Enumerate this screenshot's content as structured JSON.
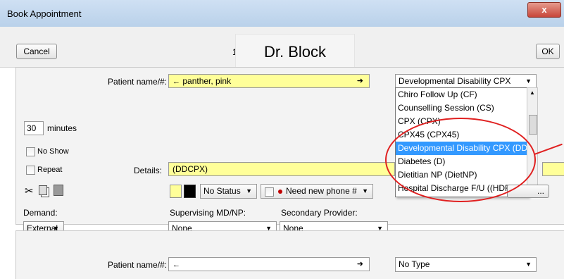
{
  "window": {
    "title": "Book Appointment",
    "close_glyph": "x"
  },
  "toolbar": {
    "cancel_label": "Cancel",
    "ok_label": "OK",
    "provider_callout": "Dr. Block",
    "stub_text": "1"
  },
  "appointment": {
    "patient_label": "Patient name/#:",
    "patient_value": "panther, pink",
    "type_selected": "Developmental Disability CPX (DDCPX)",
    "type_options": [
      "Chiro Follow Up (CF)",
      "Counselling Session (CS)",
      "CPX (CPX)",
      "CPX45 (CPX45)",
      "Developmental Disability CPX (DDCPX)",
      "Diabetes (D)",
      "Dietitian NP (DietNP)",
      "Hospital Discharge F/U ((HDF))"
    ],
    "type_highlighted_index": 4,
    "duration": "30",
    "duration_unit": "minutes",
    "no_show_label": "No Show",
    "repeat_label": "Repeat",
    "details_label": "Details:",
    "details_value": "(DDCPX)",
    "status_value": "No Status",
    "reminder_value": "Need new phone #",
    "demand_label": "Demand:",
    "demand_value": "External",
    "supervising_label": "Supervising MD/NP:",
    "supervising_value": "None",
    "secondary_label": "Secondary Provider:",
    "secondary_value": "None",
    "ellipsis_label": "..."
  },
  "second_slot": {
    "patient_label": "Patient name/#:",
    "patient_value": "",
    "type_value": "No Type"
  },
  "colors": {
    "highlight": "#ffff99",
    "selection": "#3399ff",
    "annotation_circle": "#e02020"
  },
  "icons": [
    "arrow-left-icon",
    "arrow-right-icon",
    "cut-icon",
    "copy-icon",
    "paste-icon",
    "reminder-dot-icon",
    "dropdown-arrow-icon"
  ]
}
